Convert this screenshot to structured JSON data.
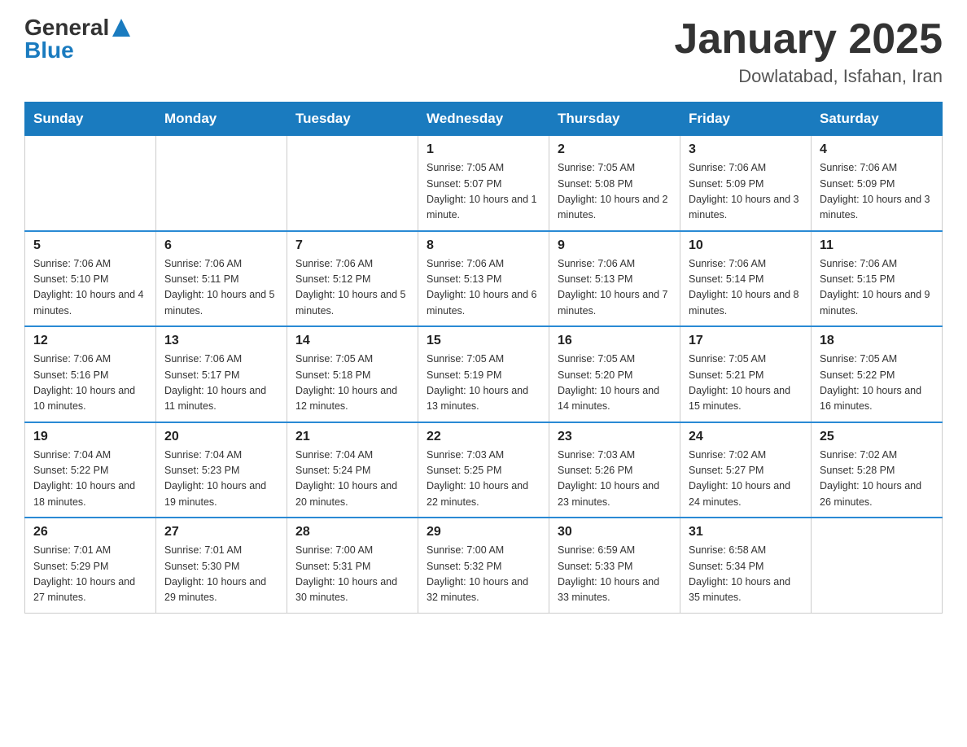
{
  "header": {
    "logo_general": "General",
    "logo_blue": "Blue",
    "month_title": "January 2025",
    "location": "Dowlatabad, Isfahan, Iran"
  },
  "weekdays": [
    "Sunday",
    "Monday",
    "Tuesday",
    "Wednesday",
    "Thursday",
    "Friday",
    "Saturday"
  ],
  "weeks": [
    [
      {
        "day": "",
        "info": ""
      },
      {
        "day": "",
        "info": ""
      },
      {
        "day": "",
        "info": ""
      },
      {
        "day": "1",
        "info": "Sunrise: 7:05 AM\nSunset: 5:07 PM\nDaylight: 10 hours\nand 1 minute."
      },
      {
        "day": "2",
        "info": "Sunrise: 7:05 AM\nSunset: 5:08 PM\nDaylight: 10 hours\nand 2 minutes."
      },
      {
        "day": "3",
        "info": "Sunrise: 7:06 AM\nSunset: 5:09 PM\nDaylight: 10 hours\nand 3 minutes."
      },
      {
        "day": "4",
        "info": "Sunrise: 7:06 AM\nSunset: 5:09 PM\nDaylight: 10 hours\nand 3 minutes."
      }
    ],
    [
      {
        "day": "5",
        "info": "Sunrise: 7:06 AM\nSunset: 5:10 PM\nDaylight: 10 hours\nand 4 minutes."
      },
      {
        "day": "6",
        "info": "Sunrise: 7:06 AM\nSunset: 5:11 PM\nDaylight: 10 hours\nand 5 minutes."
      },
      {
        "day": "7",
        "info": "Sunrise: 7:06 AM\nSunset: 5:12 PM\nDaylight: 10 hours\nand 5 minutes."
      },
      {
        "day": "8",
        "info": "Sunrise: 7:06 AM\nSunset: 5:13 PM\nDaylight: 10 hours\nand 6 minutes."
      },
      {
        "day": "9",
        "info": "Sunrise: 7:06 AM\nSunset: 5:13 PM\nDaylight: 10 hours\nand 7 minutes."
      },
      {
        "day": "10",
        "info": "Sunrise: 7:06 AM\nSunset: 5:14 PM\nDaylight: 10 hours\nand 8 minutes."
      },
      {
        "day": "11",
        "info": "Sunrise: 7:06 AM\nSunset: 5:15 PM\nDaylight: 10 hours\nand 9 minutes."
      }
    ],
    [
      {
        "day": "12",
        "info": "Sunrise: 7:06 AM\nSunset: 5:16 PM\nDaylight: 10 hours\nand 10 minutes."
      },
      {
        "day": "13",
        "info": "Sunrise: 7:06 AM\nSunset: 5:17 PM\nDaylight: 10 hours\nand 11 minutes."
      },
      {
        "day": "14",
        "info": "Sunrise: 7:05 AM\nSunset: 5:18 PM\nDaylight: 10 hours\nand 12 minutes."
      },
      {
        "day": "15",
        "info": "Sunrise: 7:05 AM\nSunset: 5:19 PM\nDaylight: 10 hours\nand 13 minutes."
      },
      {
        "day": "16",
        "info": "Sunrise: 7:05 AM\nSunset: 5:20 PM\nDaylight: 10 hours\nand 14 minutes."
      },
      {
        "day": "17",
        "info": "Sunrise: 7:05 AM\nSunset: 5:21 PM\nDaylight: 10 hours\nand 15 minutes."
      },
      {
        "day": "18",
        "info": "Sunrise: 7:05 AM\nSunset: 5:22 PM\nDaylight: 10 hours\nand 16 minutes."
      }
    ],
    [
      {
        "day": "19",
        "info": "Sunrise: 7:04 AM\nSunset: 5:22 PM\nDaylight: 10 hours\nand 18 minutes."
      },
      {
        "day": "20",
        "info": "Sunrise: 7:04 AM\nSunset: 5:23 PM\nDaylight: 10 hours\nand 19 minutes."
      },
      {
        "day": "21",
        "info": "Sunrise: 7:04 AM\nSunset: 5:24 PM\nDaylight: 10 hours\nand 20 minutes."
      },
      {
        "day": "22",
        "info": "Sunrise: 7:03 AM\nSunset: 5:25 PM\nDaylight: 10 hours\nand 22 minutes."
      },
      {
        "day": "23",
        "info": "Sunrise: 7:03 AM\nSunset: 5:26 PM\nDaylight: 10 hours\nand 23 minutes."
      },
      {
        "day": "24",
        "info": "Sunrise: 7:02 AM\nSunset: 5:27 PM\nDaylight: 10 hours\nand 24 minutes."
      },
      {
        "day": "25",
        "info": "Sunrise: 7:02 AM\nSunset: 5:28 PM\nDaylight: 10 hours\nand 26 minutes."
      }
    ],
    [
      {
        "day": "26",
        "info": "Sunrise: 7:01 AM\nSunset: 5:29 PM\nDaylight: 10 hours\nand 27 minutes."
      },
      {
        "day": "27",
        "info": "Sunrise: 7:01 AM\nSunset: 5:30 PM\nDaylight: 10 hours\nand 29 minutes."
      },
      {
        "day": "28",
        "info": "Sunrise: 7:00 AM\nSunset: 5:31 PM\nDaylight: 10 hours\nand 30 minutes."
      },
      {
        "day": "29",
        "info": "Sunrise: 7:00 AM\nSunset: 5:32 PM\nDaylight: 10 hours\nand 32 minutes."
      },
      {
        "day": "30",
        "info": "Sunrise: 6:59 AM\nSunset: 5:33 PM\nDaylight: 10 hours\nand 33 minutes."
      },
      {
        "day": "31",
        "info": "Sunrise: 6:58 AM\nSunset: 5:34 PM\nDaylight: 10 hours\nand 35 minutes."
      },
      {
        "day": "",
        "info": ""
      }
    ]
  ]
}
